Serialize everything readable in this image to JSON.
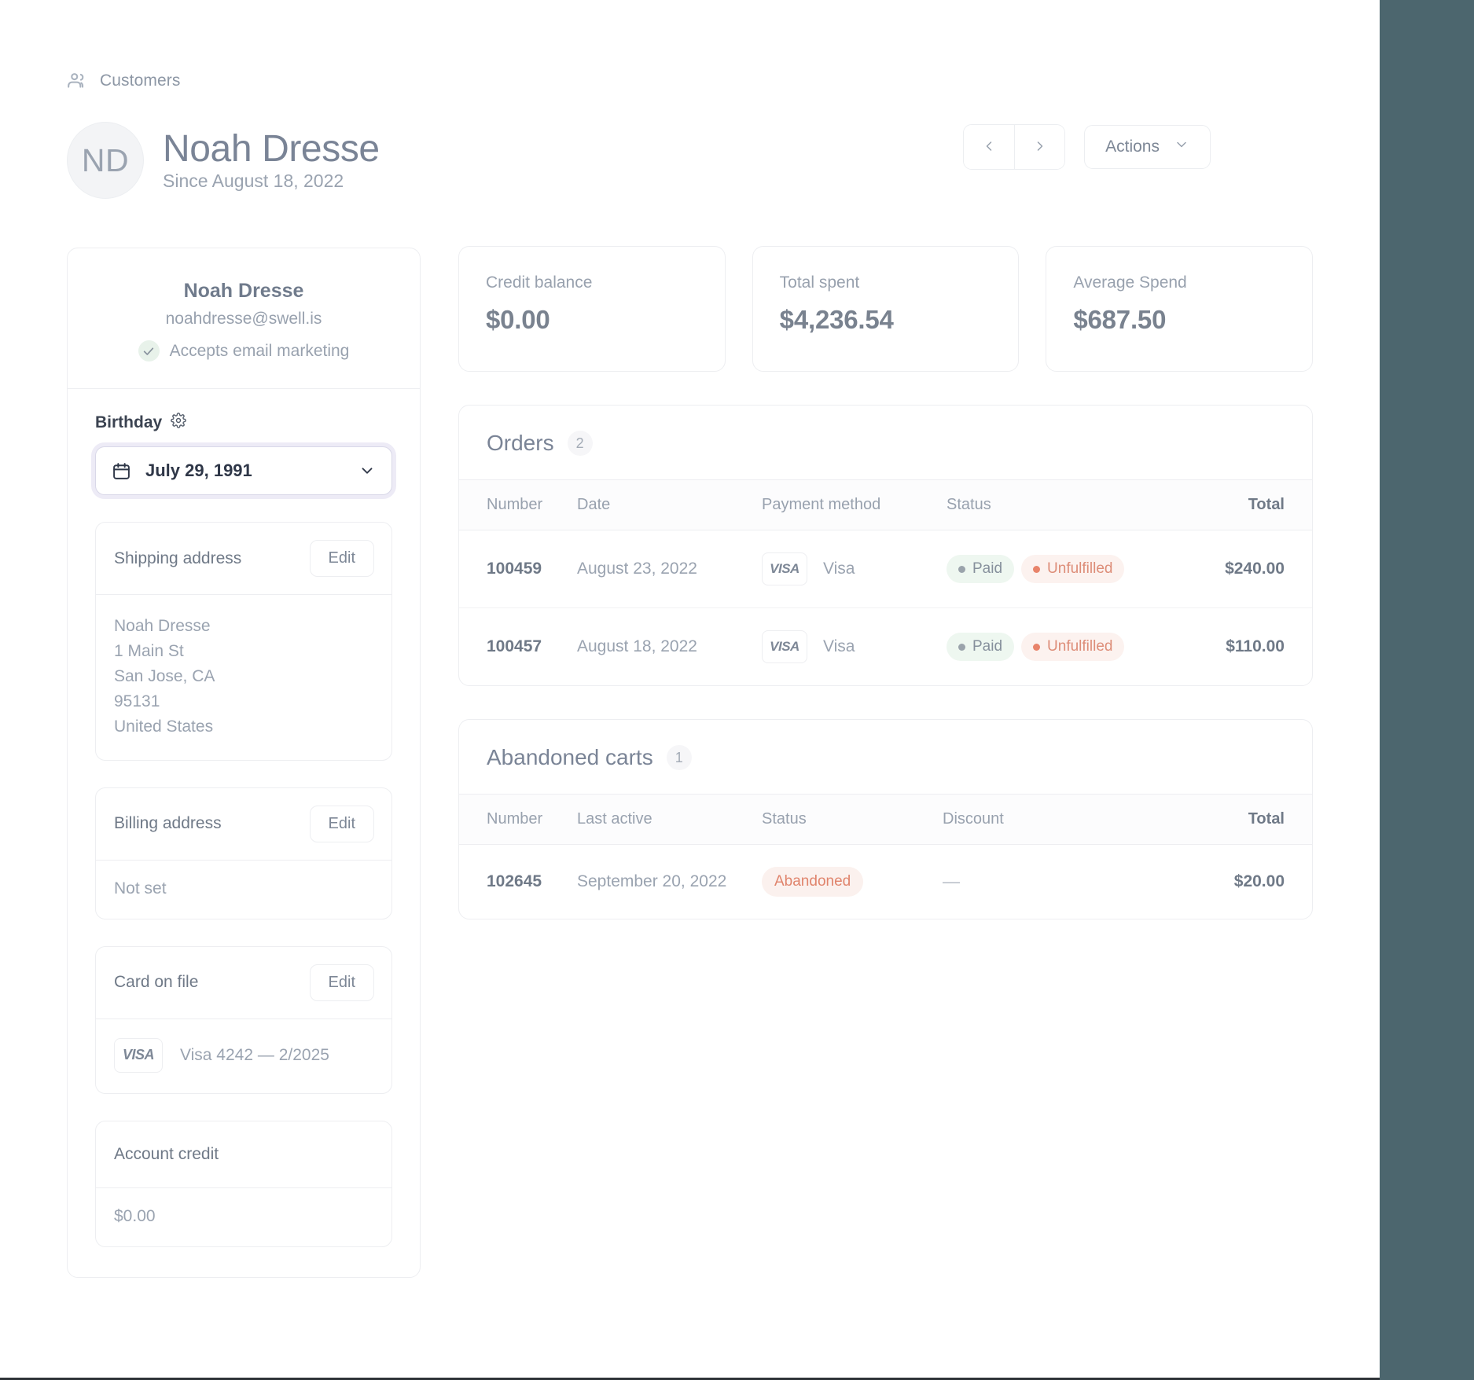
{
  "breadcrumb": {
    "icon": "users-icon",
    "label": "Customers"
  },
  "header": {
    "avatar_initials": "ND",
    "title": "Noah Dresse",
    "subtitle": "Since August 18, 2022",
    "prev_icon": "chevron-left-icon",
    "next_icon": "chevron-right-icon",
    "actions_label": "Actions",
    "actions_caret_icon": "chevron-down-icon"
  },
  "sidebar": {
    "name": "Noah Dresse",
    "email": "noahdresse@swell.is",
    "marketing_icon": "check-circle-icon",
    "marketing_label": "Accepts email marketing",
    "birthday": {
      "label": "Birthday",
      "settings_icon": "gear-icon",
      "calendar_icon": "calendar-icon",
      "value": "July 29, 1991",
      "caret_icon": "chevron-down-icon"
    },
    "shipping": {
      "title": "Shipping address",
      "edit_label": "Edit",
      "lines": [
        "Noah Dresse",
        "1 Main St",
        "San Jose, CA",
        "95131",
        "United States"
      ]
    },
    "billing": {
      "title": "Billing address",
      "edit_label": "Edit",
      "value": "Not set"
    },
    "card_on_file": {
      "title": "Card on file",
      "edit_label": "Edit",
      "brand_logo": "VISA",
      "value": "Visa 4242 — 2/2025"
    },
    "account_credit": {
      "title": "Account credit",
      "value": "$0.00"
    }
  },
  "stats": [
    {
      "label": "Credit balance",
      "value": "$0.00"
    },
    {
      "label": "Total spent",
      "value": "$4,236.54"
    },
    {
      "label": "Average Spend",
      "value": "$687.50"
    }
  ],
  "orders": {
    "title": "Orders",
    "count": "2",
    "columns": [
      "Number",
      "Date",
      "Payment method",
      "Status",
      "Total"
    ],
    "rows": [
      {
        "number": "100459",
        "date": "August 23, 2022",
        "payment_logo": "VISA",
        "payment_name": "Visa",
        "status_paid": "Paid",
        "status_fulfillment": "Unfulfilled",
        "total": "$240.00"
      },
      {
        "number": "100457",
        "date": "August 18, 2022",
        "payment_logo": "VISA",
        "payment_name": "Visa",
        "status_paid": "Paid",
        "status_fulfillment": "Unfulfilled",
        "total": "$110.00"
      }
    ]
  },
  "abandoned_carts": {
    "title": "Abandoned carts",
    "count": "1",
    "columns": [
      "Number",
      "Last active",
      "Status",
      "Discount",
      "Total"
    ],
    "rows": [
      {
        "number": "102645",
        "last_active": "September 20, 2022",
        "status": "Abandoned",
        "discount": "—",
        "total": "$20.00"
      }
    ]
  },
  "colors": {
    "accent_teal": "#4c666e",
    "paid_bg": "#eef7f0",
    "unfulfilled_text": "#dd8d78",
    "abandoned_text": "#e0846c",
    "focus_ring": "#edebf6"
  }
}
